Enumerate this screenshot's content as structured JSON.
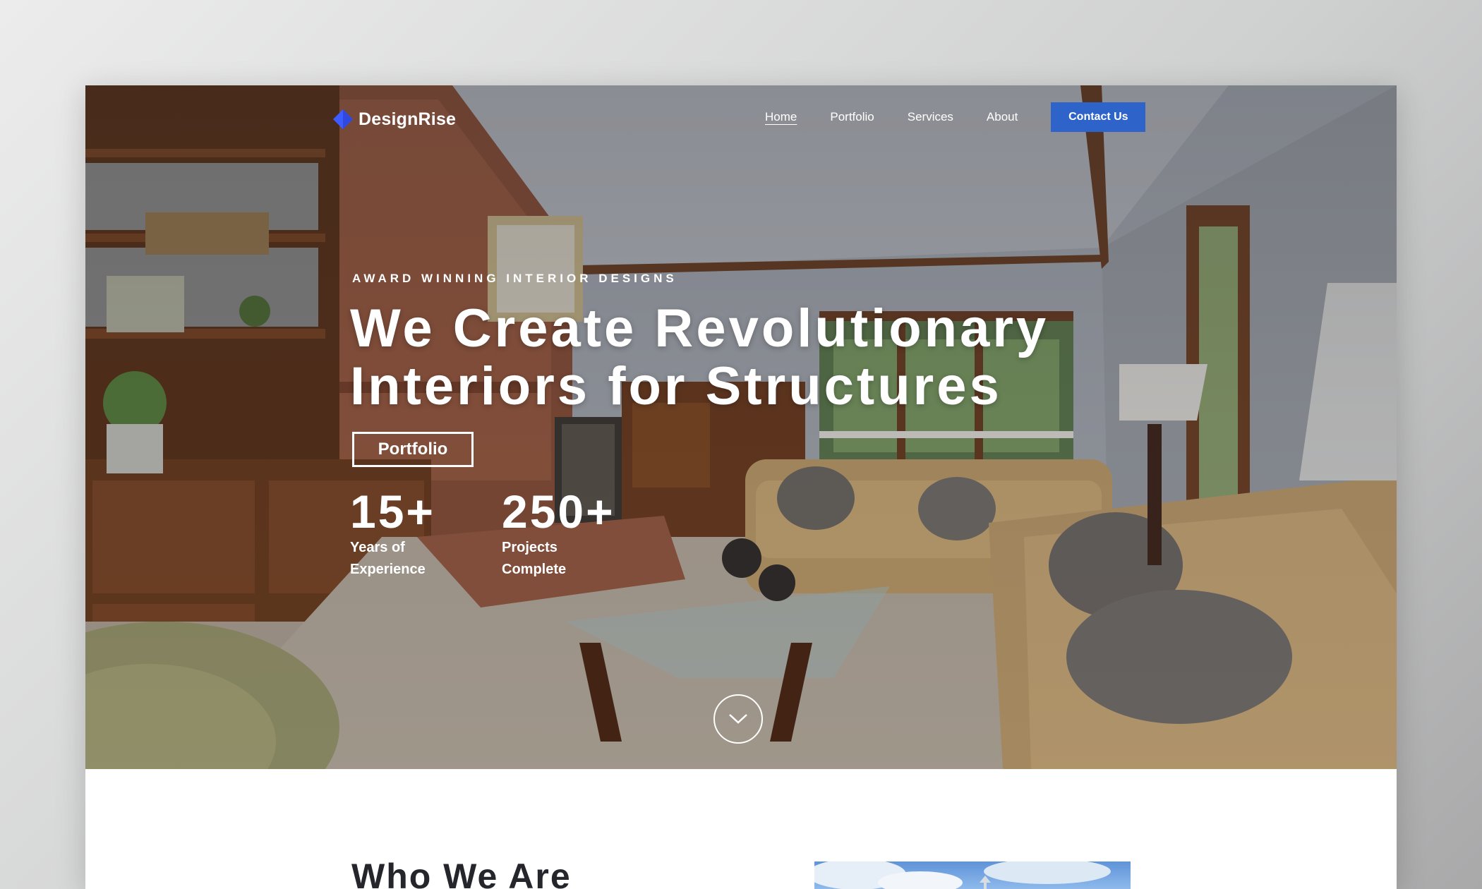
{
  "brand": {
    "name": "DesignRise",
    "accent": "#2e63c9",
    "logo_color": "#3d5cff"
  },
  "nav": {
    "items": [
      {
        "label": "Home",
        "active": true
      },
      {
        "label": "Portfolio",
        "active": false
      },
      {
        "label": "Services",
        "active": false
      },
      {
        "label": "About",
        "active": false
      }
    ],
    "cta_label": "Contact Us"
  },
  "hero": {
    "eyebrow": "AWARD WINNING INTERIOR DESIGNS",
    "headline_line1": "We Create Revolutionary",
    "headline_line2": "Interiors for Structures",
    "button_label": "Portfolio",
    "stats": [
      {
        "value": "15+",
        "label_line1": "Years of",
        "label_line2": "Experience"
      },
      {
        "value": "250+",
        "label_line1": "Projects",
        "label_line2": "Complete"
      }
    ],
    "scroll_icon": "chevron-down-icon"
  },
  "about": {
    "title": "Who We Are"
  }
}
